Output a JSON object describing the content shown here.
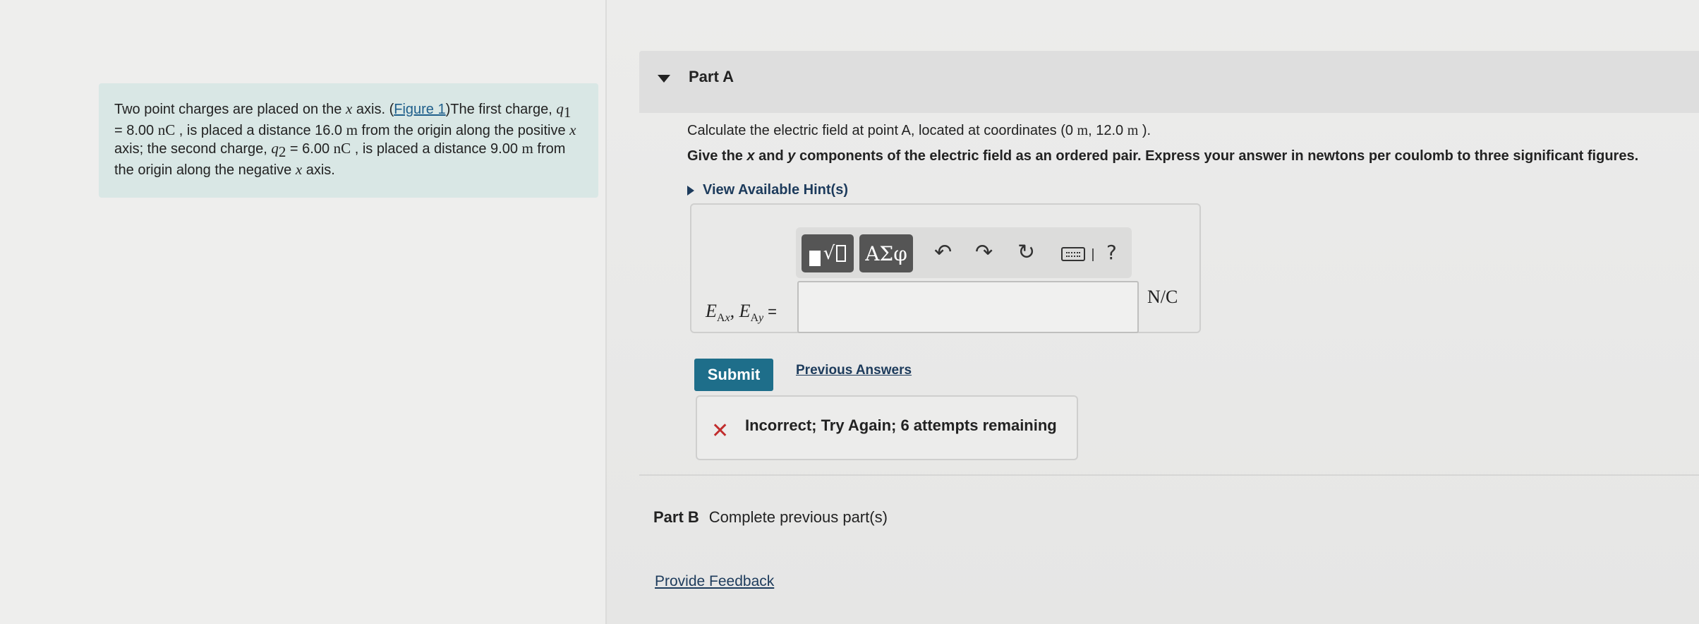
{
  "problem": {
    "text_1": "Two point charges are placed on the ",
    "x_var": "x",
    "text_2": " axis. (",
    "figure_link": "Figure 1",
    "text_3": ")The first charge, ",
    "q1_var": "q",
    "q1_sub": "1",
    "q1_value": " = 8.00 ",
    "q1_unit": "nC",
    "text_4": " , is placed a distance 16.0 ",
    "dist1_unit": "m",
    "text_5": " from the origin along the positive ",
    "text_6": " axis; the second charge, ",
    "q2_var": "q",
    "q2_sub": "2",
    "q2_value": " = 6.00 ",
    "q2_unit": "nC",
    "text_7": " , is placed a distance 9.00 ",
    "dist2_unit": "m",
    "text_8": " from the origin along the negative ",
    "text_9": " axis."
  },
  "part_a": {
    "title": "Part A",
    "question_prefix": "Calculate the electric field at point A, located at coordinates (0 ",
    "question_unit_1": "m",
    "question_mid": ", 12.0 ",
    "question_unit_2": "m",
    "question_suffix": " ).",
    "instruction_1": "Give the ",
    "instruction_x": "x",
    "instruction_2": " and ",
    "instruction_y": "y",
    "instruction_3": " components of the electric field as an ordered pair. Express your answer in newtons per coulomb to three significant figures.",
    "hints_label": "View Available Hint(s)",
    "toolbar": {
      "templates_icon": "templates-icon",
      "symbols_label": "ΑΣφ",
      "undo_icon": "undo-icon",
      "redo_icon": "redo-icon",
      "reset_icon": "reset-icon",
      "keyboard_icon": "keyboard-icon",
      "help_label": "?"
    },
    "eq_var1": "E",
    "eq_sub1_a": "A",
    "eq_sub1_b": "x",
    "eq_sep": ", ",
    "eq_var2": "E",
    "eq_sub2_a": "A",
    "eq_sub2_b": "y",
    "eq_sign": "=",
    "answer_value": "",
    "units": "N/C",
    "submit_label": "Submit",
    "previous_answers_label": "Previous Answers",
    "feedback_text": "Incorrect; Try Again; 6 attempts remaining"
  },
  "part_b": {
    "title": "Part B",
    "status": "Complete previous part(s)"
  },
  "footer": {
    "provide_feedback_label": "Provide Feedback"
  },
  "colors": {
    "submit_bg": "#1e6e8a",
    "incorrect_red": "#c12d2d",
    "problem_box_bg": "#d9e7e5",
    "link_blue": "#1d3b5c"
  }
}
